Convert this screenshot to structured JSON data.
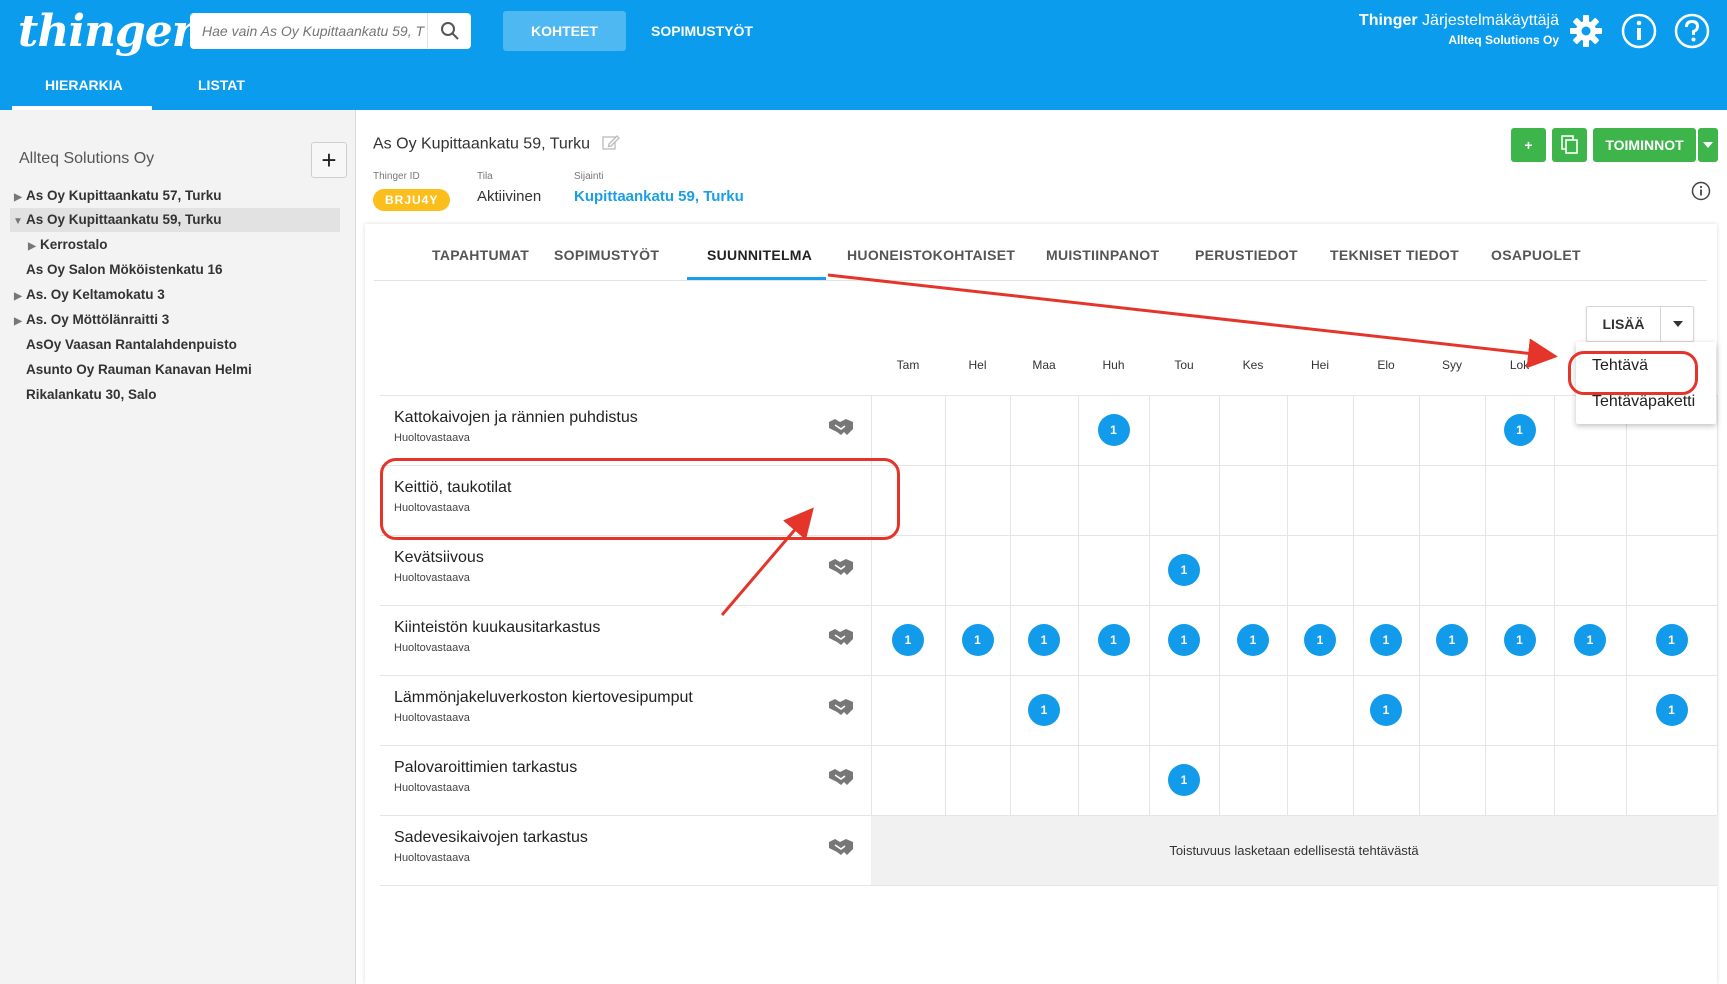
{
  "header": {
    "logo": "thinger",
    "search_placeholder": "Hae vain As Oy Kupittaankatu 59, T",
    "nav": [
      "KOHTEET",
      "SOPIMUSTYÖT"
    ],
    "user_brand": "Thinger",
    "user_role": "Järjestelmäkäyttäjä",
    "user_org": "Allteq Solutions Oy",
    "subnav": [
      "HIERARKIA",
      "LISTAT"
    ],
    "icons": [
      "gear-icon",
      "info-icon",
      "help-icon"
    ]
  },
  "sidebar": {
    "title": "Allteq Solutions Oy",
    "items": [
      {
        "label": "As Oy Kupittaankatu 57, Turku",
        "arrow": "▶"
      },
      {
        "label": "As Oy Kupittaankatu 59, Turku",
        "arrow": "▼"
      },
      {
        "label": "Kerrostalo",
        "arrow": "▶"
      },
      {
        "label": "As Oy Salon Mököistenkatu 16",
        "arrow": ""
      },
      {
        "label": "As. Oy Keltamokatu 3",
        "arrow": "▶"
      },
      {
        "label": "As. Oy Möttölänraitti 3",
        "arrow": "▶"
      },
      {
        "label": "AsOy Vaasan Rantalahdenpuisto",
        "arrow": ""
      },
      {
        "label": "Asunto Oy Rauman Kanavan Helmi",
        "arrow": ""
      },
      {
        "label": "Rikalankatu 30, Salo",
        "arrow": ""
      }
    ]
  },
  "object": {
    "title": "As Oy Kupittaankatu 59, Turku",
    "id_label": "Thinger ID",
    "id_value": "BRJU4Y",
    "status_label": "Tila",
    "status_value": "Aktiivinen",
    "location_label": "Sijainti",
    "location_value": "Kupittaankatu 59, Turku",
    "add_label": "+",
    "actions_label": "TOIMINNOT"
  },
  "tabs": [
    "TAPAHTUMAT",
    "SOPIMUSTYÖT",
    "SUUNNITELMA",
    "HUONEISTOKOHTAISET",
    "MUISTIINPANOT",
    "PERUSTIEDOT",
    "TEKNISET TIEDOT",
    "OSAPUOLET"
  ],
  "plan": {
    "add_button": "LISÄÄ",
    "dropdown": [
      "Tehtävä",
      "Tehtäväpaketti"
    ],
    "months": [
      "Tam",
      "Hel",
      "Maa",
      "Huh",
      "Tou",
      "Kes",
      "Hei",
      "Elo",
      "Syy",
      "Lok",
      "",
      ""
    ],
    "recurrence_note": "Toistuvuus lasketaan edellisestä tehtävästä",
    "rows": [
      {
        "title": "Kattokaivojen ja rännien puhdistus",
        "role": "Huoltovastaava",
        "contract": true,
        "counts": [
          0,
          0,
          0,
          1,
          0,
          0,
          0,
          0,
          0,
          1,
          0,
          0
        ]
      },
      {
        "title": "Keittiö, taukotilat",
        "role": "Huoltovastaava",
        "contract": false,
        "counts": [
          0,
          0,
          0,
          0,
          0,
          0,
          0,
          0,
          0,
          0,
          0,
          0
        ]
      },
      {
        "title": "Kevätsiivous",
        "role": "Huoltovastaava",
        "contract": true,
        "counts": [
          0,
          0,
          0,
          0,
          1,
          0,
          0,
          0,
          0,
          0,
          0,
          0
        ]
      },
      {
        "title": "Kiinteistön kuukausitarkastus",
        "role": "Huoltovastaava",
        "contract": true,
        "counts": [
          1,
          1,
          1,
          1,
          1,
          1,
          1,
          1,
          1,
          1,
          1,
          1
        ]
      },
      {
        "title": "Lämmönjakeluverkoston kiertovesipumput",
        "role": "Huoltovastaava",
        "contract": true,
        "counts": [
          0,
          0,
          1,
          0,
          0,
          0,
          0,
          1,
          0,
          0,
          0,
          1
        ]
      },
      {
        "title": "Palovaroittimien tarkastus",
        "role": "Huoltovastaava",
        "contract": true,
        "counts": [
          0,
          0,
          0,
          0,
          1,
          0,
          0,
          0,
          0,
          0,
          0,
          0
        ]
      },
      {
        "title": "Sadevesikaivojen tarkastus",
        "role": "Huoltovastaava",
        "contract": true,
        "recurring": true,
        "counts": []
      }
    ]
  },
  "colors": {
    "brand": "#0b9ced",
    "accent": "#1a9fe6",
    "dot": "#129bea",
    "badge": "#fbbf1d",
    "green": "#3eb54a",
    "annotation": "#e5352b"
  }
}
